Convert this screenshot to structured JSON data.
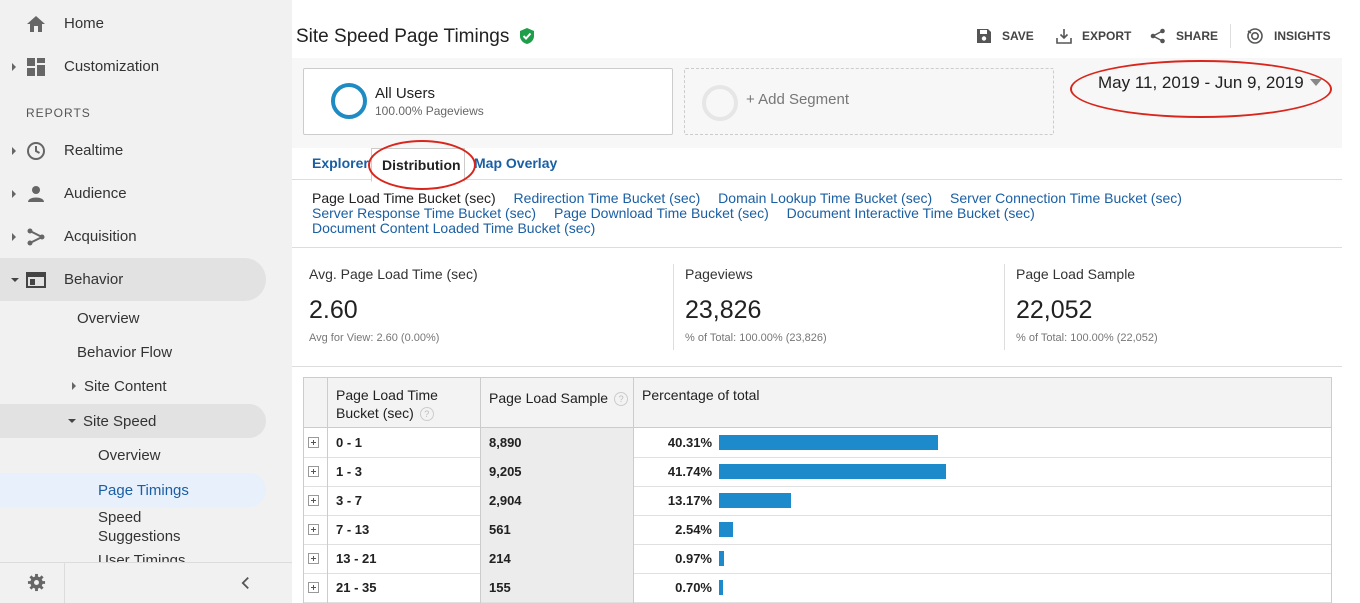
{
  "sidebar": {
    "home": "Home",
    "customization": "Customization",
    "reports_label": "REPORTS",
    "realtime": "Realtime",
    "audience": "Audience",
    "acquisition": "Acquisition",
    "behavior": "Behavior",
    "behavior_overview": "Overview",
    "behavior_flow": "Behavior Flow",
    "site_content": "Site Content",
    "site_speed": "Site Speed",
    "speed_overview": "Overview",
    "page_timings": "Page Timings",
    "speed_suggestions": "Speed Suggestions",
    "partial_next": "User Timings"
  },
  "header": {
    "title": "Site Speed Page Timings",
    "save": "SAVE",
    "export": "EXPORT",
    "share": "SHARE",
    "insights": "INSIGHTS"
  },
  "segments": {
    "active_name": "All Users",
    "active_sub": "100.00% Pageviews",
    "add_label": "+ Add Segment"
  },
  "date_range": "May 11, 2019 - Jun 9, 2019",
  "tabs": {
    "explorer": "Explorer",
    "distribution": "Distribution",
    "map_overlay": "Map Overlay"
  },
  "buckets": {
    "current": "Page Load Time Bucket (sec)",
    "links": [
      "Redirection Time Bucket (sec)",
      "Domain Lookup Time Bucket (sec)",
      "Server Connection Time Bucket (sec)",
      "Server Response Time Bucket (sec)",
      "Page Download Time Bucket (sec)",
      "Document Interactive Time Bucket (sec)",
      "Document Content Loaded Time Bucket (sec)"
    ]
  },
  "metrics": [
    {
      "label": "Avg. Page Load Time (sec)",
      "value": "2.60",
      "sub": "Avg for View: 2.60 (0.00%)"
    },
    {
      "label": "Pageviews",
      "value": "23,826",
      "sub": "% of Total: 100.00% (23,826)"
    },
    {
      "label": "Page Load Sample",
      "value": "22,052",
      "sub": "% of Total: 100.00% (22,052)"
    }
  ],
  "table": {
    "col_bucket_line1": "Page Load Time",
    "col_bucket_line2": "Bucket (sec)",
    "col_sample": "Page Load Sample",
    "col_pct": "Percentage of total",
    "rows": [
      {
        "bucket": "0 - 1",
        "sample": "8,890",
        "pct_label": "40.31%",
        "pct": 40.31
      },
      {
        "bucket": "1 - 3",
        "sample": "9,205",
        "pct_label": "41.74%",
        "pct": 41.74
      },
      {
        "bucket": "3 - 7",
        "sample": "2,904",
        "pct_label": "13.17%",
        "pct": 13.17
      },
      {
        "bucket": "7 - 13",
        "sample": "561",
        "pct_label": "2.54%",
        "pct": 2.54
      },
      {
        "bucket": "13 - 21",
        "sample": "214",
        "pct_label": "0.97%",
        "pct": 0.97
      },
      {
        "bucket": "21 - 35",
        "sample": "155",
        "pct_label": "0.70%",
        "pct": 0.7
      }
    ]
  },
  "colors": {
    "accent": "#1a5fa4",
    "bar": "#1d8acb",
    "annotation": "#d9261c",
    "verified": "#1e9e4a"
  },
  "icons": {
    "home": "home-icon",
    "customization": "dashboard-grid-icon",
    "realtime": "clock-icon",
    "audience": "person-icon",
    "acquisition": "branch-icon",
    "behavior": "window-icon",
    "verified": "verified-shield-icon",
    "save": "floppy-disk-icon",
    "export": "download-icon",
    "share": "share-icon",
    "insights": "insights-icon",
    "settings": "gear-icon",
    "collapse": "chevron-left-icon"
  }
}
